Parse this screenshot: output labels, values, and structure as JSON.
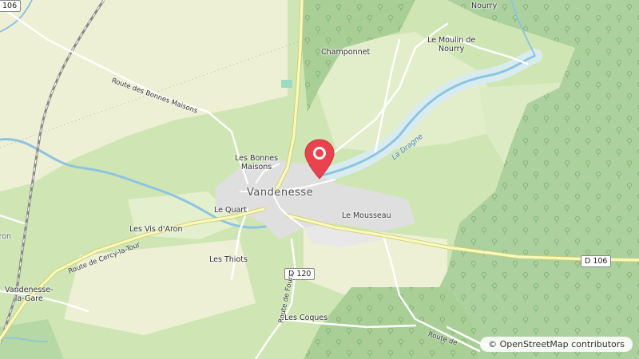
{
  "map": {
    "roads": {
      "n106_shield": "106",
      "d106_shield": "D 106",
      "d120_shield": "D 120",
      "route_bonnes_maisons": "Route des Bonnes Maisons",
      "route_cercy": "Route de Cercy-la-Tour",
      "route_fours": "Route de Fours",
      "route_se": "Route de"
    },
    "river_name": "La Dragne",
    "town": "Vandenesse",
    "places": {
      "nourry": "Nourry",
      "moulin": "Le Moulin de\nNourry",
      "champonnet": "Champonnet",
      "bonnes_maisons": "Les Bonnes\nMaisons",
      "le_quart": "Le Quart",
      "le_mousseau": "Le Mousseau",
      "vis_daron": "Les Vis d'Aron",
      "les_thiots": "Les Thiots",
      "vandenesse_gare": "Vandenesse-\nla-Gare",
      "les_coques": "Les Coques",
      "aron": "Aron"
    },
    "attribution": "© OpenStreetMap contributors",
    "colors": {
      "meadow": "#cfe6b4",
      "farmland": "#eef0d6",
      "forest": "#add19e",
      "water": "#aad3df",
      "river": "#8fc4e0",
      "marker": "#e8434f"
    }
  }
}
